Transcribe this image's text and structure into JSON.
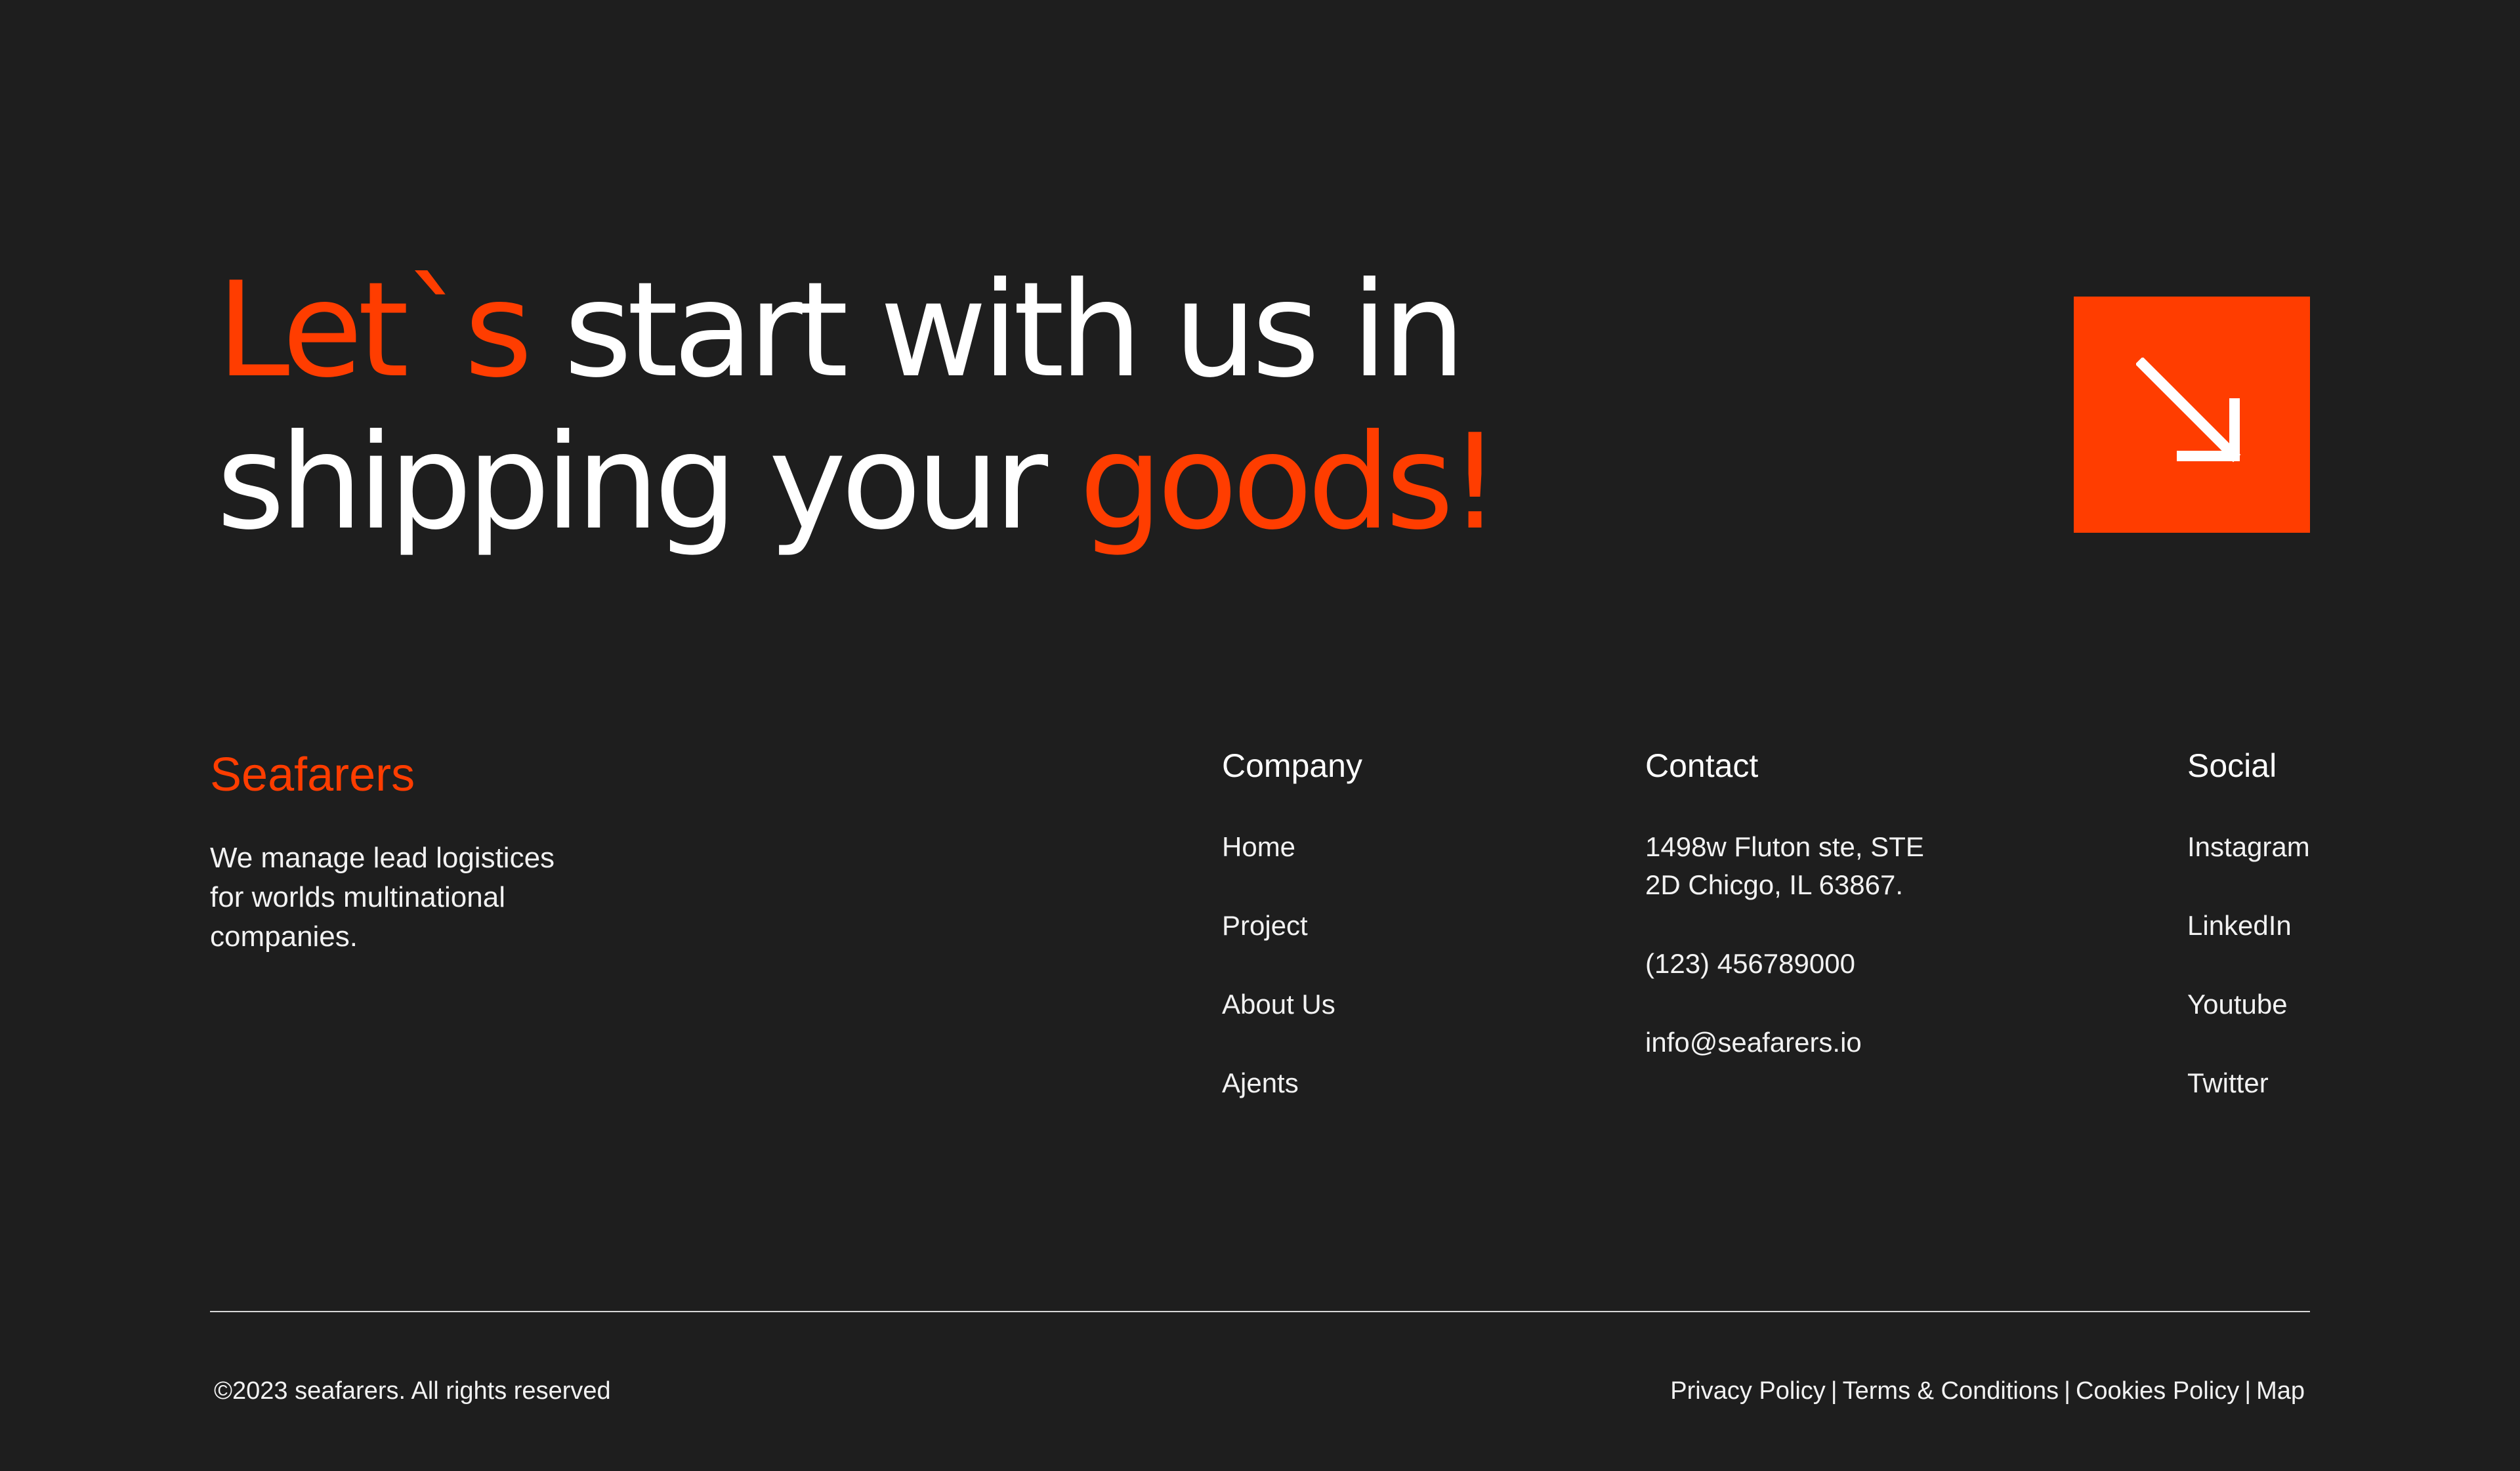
{
  "hero": {
    "line1_accent": "Let`s",
    "line1_rest": " start with us in",
    "line2_rest": "shipping your ",
    "line2_accent": "goods!"
  },
  "cta": {
    "icon": "arrow-down-right-icon",
    "color": "#ff3d00"
  },
  "brand": {
    "name": "Seafarers",
    "tagline_lines": [
      "We manage lead logistices",
      "for worlds multinational",
      "companies."
    ]
  },
  "company": {
    "title": "Company",
    "items": [
      "Home",
      "Project",
      "About Us",
      "Ajents"
    ]
  },
  "contact": {
    "title": "Contact",
    "address_lines": [
      "1498w Fluton ste, STE",
      "2D Chicgo, IL 63867."
    ],
    "phone": "(123) 456789000",
    "email": "info@seafarers.io"
  },
  "social": {
    "title": "Social",
    "items": [
      "Instagram",
      "LinkedIn",
      "Youtube",
      "Twitter"
    ]
  },
  "footer": {
    "copyright": "©2023 seafarers. All rights reserved",
    "links": [
      "Privacy Policy",
      "Terms & Conditions",
      "Cookies Policy",
      "Map"
    ],
    "separator": "|"
  },
  "colors": {
    "accent": "#ff3d00",
    "background": "#1e1e1e",
    "text": "#ffffff"
  }
}
